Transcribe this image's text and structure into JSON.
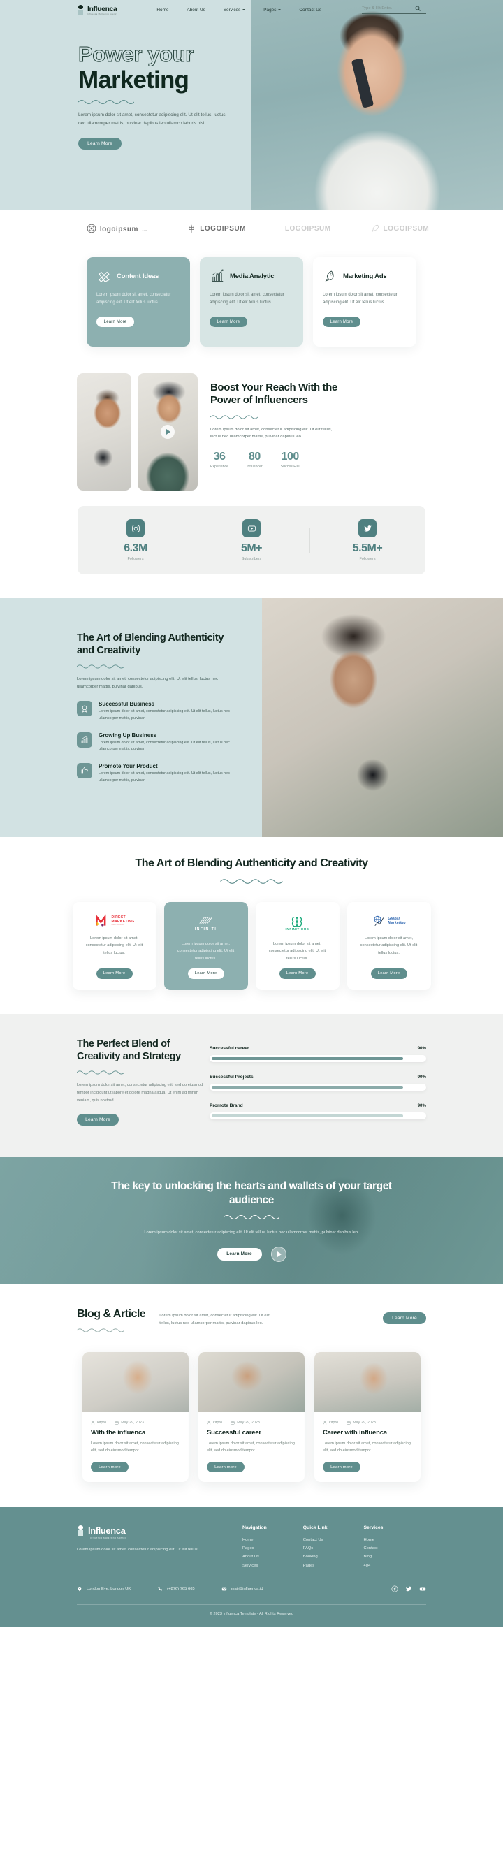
{
  "brand": {
    "name": "Influenca",
    "tagline": "Influenca Marketing Agency"
  },
  "nav": {
    "links": [
      {
        "label": "Home",
        "caret": false
      },
      {
        "label": "About Us",
        "caret": false
      },
      {
        "label": "Services",
        "caret": true
      },
      {
        "label": "Pages",
        "caret": true
      },
      {
        "label": "Contact Us",
        "caret": false
      }
    ],
    "search_placeholder": "Type & Hit Enter..",
    "search_value": "",
    "search_icon": "search-icon"
  },
  "hero": {
    "title_line1": "Power your",
    "title_line2": "Marketing",
    "desc": "Lorem ipsum dolor sit amet, consectetur adipiscing elit. Ut elit tellus, luctus nec ullamcorper mattis, pulvinar dapibus leo ullamco laboris nisi.",
    "cta": "Learn More"
  },
  "logos": [
    {
      "text": "logoipsum",
      "sub": ".com",
      "mark": "spiral-icon",
      "muted": false
    },
    {
      "text": "LOGOIPSUM",
      "sub": "",
      "mark": "wheat-icon",
      "muted": false
    },
    {
      "text": "LOGOIPSUM",
      "sub": "",
      "mark": "",
      "muted": true
    },
    {
      "text": "LOGOIPSUM",
      "sub": "",
      "mark": "feather-icon",
      "muted": true
    }
  ],
  "services": [
    {
      "title": "Content Ideas",
      "icon": "pencil-ruler-icon",
      "desc": "Lorem ipsum dolor sit amet, consectetur adipiscing elit. Ut elit tellus luctus.",
      "cta": "Learn More",
      "style": "teal"
    },
    {
      "title": "Media Analytic",
      "icon": "chart-bars-icon",
      "desc": "Lorem ipsum dolor sit amet, consectetur adipiscing elit. Ut elit tellus luctus.",
      "cta": "Learn More",
      "style": "pale"
    },
    {
      "title": "Marketing Ads",
      "icon": "rocket-icon",
      "desc": "Lorem ipsum dolor sit amet, consectetur adipiscing elit. Ut elit tellus luctus.",
      "cta": "Learn More",
      "style": "white"
    }
  ],
  "boost": {
    "title": "Boost Your Reach With the Power of Influencers",
    "desc": "Lorem ipsum dolor sit amet, consectetur adipiscing elit. Ut elit tellus, luctus nec ullamcorper mattis, pulvinar dapibus leo.",
    "stats": [
      {
        "num": "36",
        "label": "Experience"
      },
      {
        "num": "80",
        "label": "Influencer"
      },
      {
        "num": "100",
        "label": "Succes Full"
      }
    ]
  },
  "socialstats": [
    {
      "icon": "instagram-icon",
      "value": "6.3M",
      "label": "Followers"
    },
    {
      "icon": "youtube-icon",
      "value": "5M+",
      "label": "Subscribers"
    },
    {
      "icon": "twitter-icon",
      "value": "5.5M+",
      "label": "Followers"
    }
  ],
  "blend": {
    "title": "The Art of Blending Authenticity and Creativity",
    "desc": "Lorem ipsum dolor sit amet, consectetur adipiscing elit. Ut elit tellus, luctus nec ullamcorper mattis, pulvinar dapibus.",
    "features": [
      {
        "icon": "badge-award-icon",
        "title": "Successful Business",
        "desc": "Lorem ipsum dolor sit amet, consectetur adipiscing elit. Ut elit tellus, luctus nec ullamcorper mattis, pulvinar."
      },
      {
        "icon": "growth-chart-icon",
        "title": "Growing Up Business",
        "desc": "Lorem ipsum dolor sit amet, consectetur adipiscing elit. Ut elit tellus, luctus nec ullamcorper mattis, pulvinar."
      },
      {
        "icon": "thumbs-up-icon",
        "title": "Promote Your Product",
        "desc": "Lorem ipsum dolor sit amet, consectetur adipiscing elit. Ut elit tellus, luctus nec ullamcorper mattis, pulvinar."
      }
    ]
  },
  "partners_section": {
    "title": "The Art of Blending Authenticity and Creativity",
    "cards": [
      {
        "logo_main": "DIRECT",
        "logo_sub": "MARKETING",
        "logo_small": "make awesome",
        "logo_kind": "direct-marketing-logo",
        "desc": "Lorem ipsum dolor sit amet, consectetur adipiscing elit. Ut elit tellus luctus.",
        "cta": "Learn More",
        "active": false
      },
      {
        "logo_main": "INFINITI",
        "logo_sub": "",
        "logo_small": "",
        "logo_kind": "infiniti-logo",
        "desc": "Lorem ipsum dolor sit amet, consectetur adipiscing elit. Ut elit tellus luctus.",
        "cta": "Learn More",
        "active": true
      },
      {
        "logo_main": "INFINITIOUS",
        "logo_sub": "",
        "logo_small": "",
        "logo_kind": "infinitious-logo",
        "desc": "Lorem ipsum dolor sit amet, consectetur adipiscing elit. Ut elit tellus luctus.",
        "cta": "Learn More",
        "active": false
      },
      {
        "logo_main": "Global",
        "logo_sub": "Marketing",
        "logo_small": "",
        "logo_kind": "global-marketing-logo",
        "desc": "Lorem ipsum dolor sit amet, consectetur adipiscing elit. Ut elit tellus luctus.",
        "cta": "Learn More",
        "active": false
      }
    ]
  },
  "skills": {
    "title": "The Perfect Blend of Creativity and Strategy",
    "desc": "Lorem ipsum dolor sit amet, consectetur adipiscing elit, sed do eiusmod tempor incididunt ut labore et dolore magna aliqua. Ut enim ad minim veniam, quis nostrud.",
    "cta": "Learn More",
    "bars": [
      {
        "label": "Successful career",
        "pct": "90%",
        "value": 90,
        "tone": "dark"
      },
      {
        "label": "Successful Projects",
        "pct": "90%",
        "value": 90,
        "tone": "mid"
      },
      {
        "label": "Promote Brand",
        "pct": "90%",
        "value": 90,
        "tone": "pale"
      }
    ]
  },
  "cta_banner": {
    "title": "The key to unlocking the hearts and wallets of your target audience",
    "desc": "Lorem ipsum dolor sit amet, consectetur adipiscing elit. Ut elit tellus, luctus nec ullamcorper mattis, pulvinar dapibus leo.",
    "button": "Learn More",
    "play_icon": "play-icon"
  },
  "blog": {
    "title": "Blog & Article",
    "lead": "Lorem ipsum dolor sit amet, consectetur adipiscing elit. Ut elit tellus, luctus nec ullamcorper mattis, pulvinar dapibus leo.",
    "cta": "Learn More",
    "posts": [
      {
        "author": "kitpro",
        "date": "May 29, 2023",
        "title": "With the influenca",
        "desc": "Lorem ipsum dolor sit amet, consectetur adipiscing elit, sed do eiusmod tempor.",
        "cta": "Learn more"
      },
      {
        "author": "kitpro",
        "date": "May 29, 2023",
        "title": "Successful career",
        "desc": "Lorem ipsum dolor sit amet, consectetur adipiscing elit, sed do eiusmod tempor.",
        "cta": "Learn more"
      },
      {
        "author": "kitpro",
        "date": "May 29, 2023",
        "title": "Career with influenca",
        "desc": "Lorem ipsum dolor sit amet, consectetur adipiscing elit, sed do eiusmod tempor.",
        "cta": "Learn more"
      }
    ]
  },
  "footer": {
    "about": "Lorem ipsum dolor sit amet, consectetur adipiscing elit. Ut elit tellus.",
    "columns": [
      {
        "heading": "Navigation",
        "items": [
          "Home",
          "Pages",
          "About Us",
          "Services"
        ]
      },
      {
        "heading": "Quick Link",
        "items": [
          "Contact Us",
          "FAQs",
          "Booking",
          "Pages"
        ]
      },
      {
        "heading": "Services",
        "items": [
          "Home",
          "Contact",
          "Blog",
          "404"
        ]
      }
    ],
    "contact": {
      "address": "London Eye, London UK",
      "phone": "(+876) 765 665",
      "email": "mail@influenca.id"
    },
    "socials": [
      "facebook-icon",
      "twitter-icon",
      "youtube-icon"
    ],
    "copyright": "© 2023 Influenca Template - All Rights Reserved"
  },
  "colors": {
    "teal": "#5f8e8d",
    "teal_dark": "#4f8080",
    "teal_light": "#8db0b0",
    "pale": "#d2e2e3",
    "ink": "#12261f",
    "footer": "#649090"
  }
}
